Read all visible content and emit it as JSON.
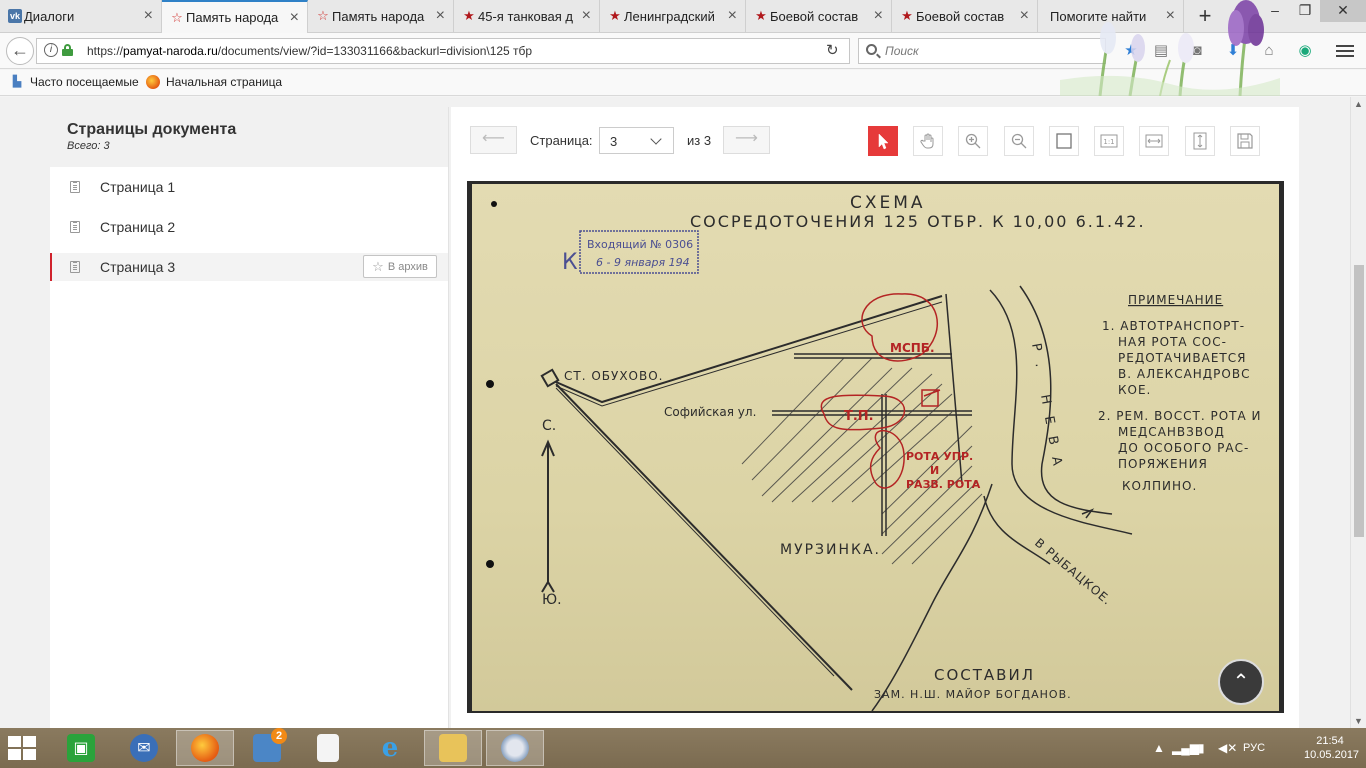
{
  "browser": {
    "tabs": [
      {
        "label": "Диалоги",
        "icon": "vk-icon",
        "active": false
      },
      {
        "label": "Память народа",
        "icon": "star-outline-icon",
        "active": true
      },
      {
        "label": "Память народа",
        "icon": "star-outline-icon",
        "active": false
      },
      {
        "label": "45-я танковая д",
        "icon": "star-filled-icon",
        "active": false
      },
      {
        "label": "Ленинградский",
        "icon": "star-filled-icon",
        "active": false
      },
      {
        "label": "Боевой состав",
        "icon": "star-filled-icon",
        "active": false
      },
      {
        "label": "Боевой состав",
        "icon": "star-filled-icon",
        "active": false
      },
      {
        "label": "Помогите найти",
        "icon": "",
        "active": false
      }
    ],
    "url_host": "pamyat-naroda.ru",
    "url_prefix": "https://",
    "url_path": "/documents/view/?id=133031166&backurl=division\\125 тбр",
    "search_placeholder": "Поиск",
    "bookmarks": [
      {
        "label": "Часто посещаемые",
        "icon": "bookmark-folder-icon"
      },
      {
        "label": "Начальная страница",
        "icon": "firefox-icon"
      }
    ]
  },
  "sidebar": {
    "title": "Страницы документа",
    "count": "Всего: 3",
    "pages": [
      {
        "label": "Страница 1"
      },
      {
        "label": "Страница 2"
      },
      {
        "label": "Страница 3"
      }
    ],
    "archive_label": "В архив"
  },
  "viewer": {
    "page_label": "Страница:",
    "current_page": "3",
    "page_of": "из 3"
  },
  "document": {
    "heading_1": "СХЕМА",
    "heading_2": "СОСРЕДОТОЧЕНИЯ 125 ОТБР. К 10,00 6.1.42.",
    "stamp_1": "Входящий № 0306",
    "stamp_2": "6 - 9 января 194",
    "stamp_prefix": "К",
    "label_station": "СТ. ОБУХОВО.",
    "label_street": "Софийская ул.",
    "label_murzinka": "МУРЗИНКА.",
    "label_north": "С.",
    "label_south": "Ю.",
    "label_neva": "Р. НЕВА",
    "label_rybatskoe": "В РЫБАЦКОЕ.",
    "label_mspb": "МСПБ.",
    "label_tp": "Т.П.",
    "label_hq_1": "РОТА УПР.",
    "label_hq_2": "И",
    "label_hq_3": "РАЗВ. РОТА",
    "note_title": "ПРИМЕЧАНИЕ",
    "note_lines": [
      "1. АВТОТРАНСПОРТ-",
      "НАЯ РОТА СОС-",
      "РЕДОТАЧИВАЕТСЯ",
      "В. АЛЕКСАНДРОВС",
      "КОЕ.",
      "2. РЕМ. ВОССТ. РОТА И",
      "МЕДСАНВЗВОД",
      "ДО ОСОБОГО РАС-",
      "ПОРЯЖЕНИЯ",
      "КОЛПИНО."
    ],
    "signature_1": "СОСТАВИЛ",
    "signature_2": "ЗАМ. Н.Ш. МАЙОР БОГДАНОВ.",
    "paper_color": "#dcd4a6",
    "ink_red": "#b42424"
  },
  "taskbar": {
    "lang": "РУС",
    "time": "21:54",
    "date": "10.05.2017",
    "badge": "2"
  }
}
